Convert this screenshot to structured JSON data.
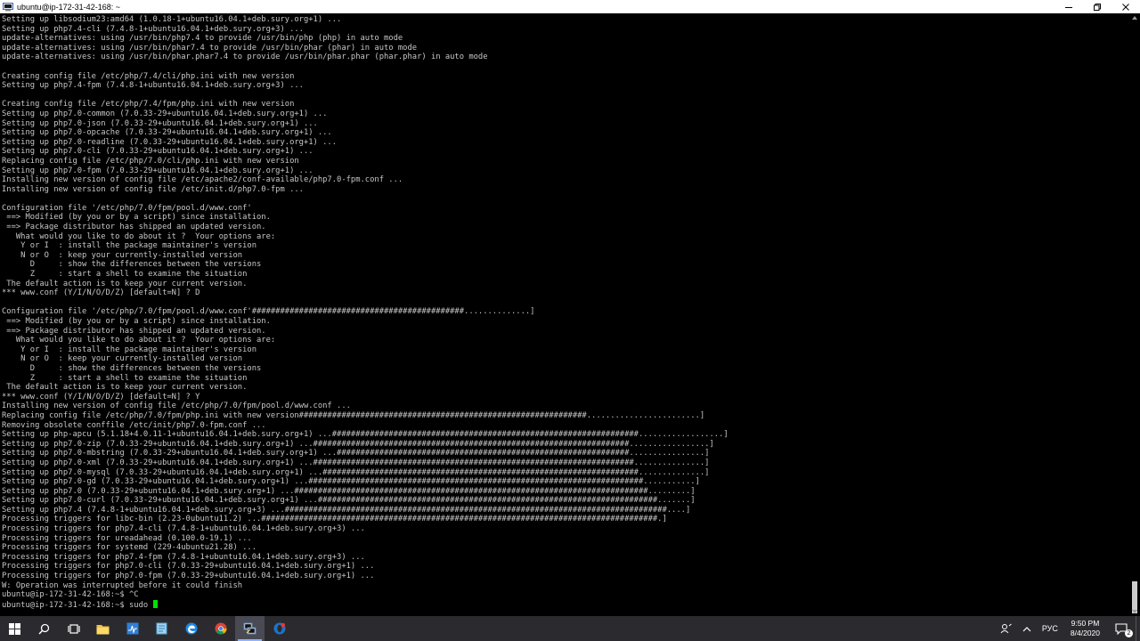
{
  "window": {
    "title": "ubuntu@ip-172-31-42-168: ~"
  },
  "terminal": {
    "lines": [
      "Setting up libsodium23:amd64 (1.0.18-1+ubuntu16.04.1+deb.sury.org+1) ...",
      "Setting up php7.4-cli (7.4.8-1+ubuntu16.04.1+deb.sury.org+3) ...",
      "update-alternatives: using /usr/bin/php7.4 to provide /usr/bin/php (php) in auto mode",
      "update-alternatives: using /usr/bin/phar7.4 to provide /usr/bin/phar (phar) in auto mode",
      "update-alternatives: using /usr/bin/phar.phar7.4 to provide /usr/bin/phar.phar (phar.phar) in auto mode",
      "",
      "Creating config file /etc/php/7.4/cli/php.ini with new version",
      "Setting up php7.4-fpm (7.4.8-1+ubuntu16.04.1+deb.sury.org+3) ...",
      "",
      "Creating config file /etc/php/7.4/fpm/php.ini with new version",
      "Setting up php7.0-common (7.0.33-29+ubuntu16.04.1+deb.sury.org+1) ...",
      "Setting up php7.0-json (7.0.33-29+ubuntu16.04.1+deb.sury.org+1) ...",
      "Setting up php7.0-opcache (7.0.33-29+ubuntu16.04.1+deb.sury.org+1) ...",
      "Setting up php7.0-readline (7.0.33-29+ubuntu16.04.1+deb.sury.org+1) ...",
      "Setting up php7.0-cli (7.0.33-29+ubuntu16.04.1+deb.sury.org+1) ...",
      "Replacing config file /etc/php/7.0/cli/php.ini with new version",
      "Setting up php7.0-fpm (7.0.33-29+ubuntu16.04.1+deb.sury.org+1) ...",
      "Installing new version of config file /etc/apache2/conf-available/php7.0-fpm.conf ...",
      "Installing new version of config file /etc/init.d/php7.0-fpm ...",
      "",
      "Configuration file '/etc/php/7.0/fpm/pool.d/www.conf'",
      " ==> Modified (by you or by a script) since installation.",
      " ==> Package distributor has shipped an updated version.",
      "   What would you like to do about it ?  Your options are:",
      "    Y or I  : install the package maintainer's version",
      "    N or O  : keep your currently-installed version",
      "      D     : show the differences between the versions",
      "      Z     : start a shell to examine the situation",
      " The default action is to keep your current version.",
      "*** www.conf (Y/I/N/O/D/Z) [default=N] ? D",
      "",
      "Configuration file '/etc/php/7.0/fpm/pool.d/www.conf'#############################################..............]",
      " ==> Modified (by you or by a script) since installation.",
      " ==> Package distributor has shipped an updated version.",
      "   What would you like to do about it ?  Your options are:",
      "    Y or I  : install the package maintainer's version",
      "    N or O  : keep your currently-installed version",
      "      D     : show the differences between the versions",
      "      Z     : start a shell to examine the situation",
      " The default action is to keep your current version.",
      "*** www.conf (Y/I/N/O/D/Z) [default=N] ? Y",
      "Installing new version of config file /etc/php/7.0/fpm/pool.d/www.conf ...",
      "Replacing config file /etc/php/7.0/fpm/php.ini with new version#############################################################........................]",
      "Removing obsolete conffile /etc/init/php7.0-fpm.conf ...",
      "Setting up php-apcu (5.1.18+4.0.11-1+ubuntu16.04.1+deb.sury.org+1) ...#################################################################..................]",
      "Setting up php7.0-zip (7.0.33-29+ubuntu16.04.1+deb.sury.org+1) ...###################################################################.................]",
      "Setting up php7.0-mbstring (7.0.33-29+ubuntu16.04.1+deb.sury.org+1) ...##############################################################................]",
      "Setting up php7.0-xml (7.0.33-29+ubuntu16.04.1+deb.sury.org+1) ...####################################################################...............]",
      "Setting up php7.0-mysql (7.0.33-29+ubuntu16.04.1+deb.sury.org+1) ...###################################################################..............]",
      "Setting up php7.0-gd (7.0.33-29+ubuntu16.04.1+deb.sury.org+1) ...#######################################################################...........]",
      "Setting up php7.0 (7.0.33-29+ubuntu16.04.1+deb.sury.org+1) ...###########################################################################.........]",
      "Setting up php7.0-curl (7.0.33-29+ubuntu16.04.1+deb.sury.org+1) ...########################################################################.......]",
      "Setting up php7.4 (7.4.8-1+ubuntu16.04.1+deb.sury.org+3) ...#################################################################################....]",
      "Processing triggers for libc-bin (2.23-0ubuntu11.2) ...####################################################################################.]",
      "Processing triggers for php7.4-cli (7.4.8-1+ubuntu16.04.1+deb.sury.org+3) ...",
      "Processing triggers for ureadahead (0.100.0-19.1) ...",
      "Processing triggers for systemd (229-4ubuntu21.28) ...",
      "Processing triggers for php7.4-fpm (7.4.8-1+ubuntu16.04.1+deb.sury.org+3) ...",
      "Processing triggers for php7.0-cli (7.0.33-29+ubuntu16.04.1+deb.sury.org+1) ...",
      "Processing triggers for php7.0-fpm (7.0.33-29+ubuntu16.04.1+deb.sury.org+1) ...",
      "W: Operation was interrupted before it could finish",
      "ubuntu@ip-172-31-42-168:~$ ^C"
    ],
    "prompt": "ubuntu@ip-172-31-42-168:~$ sudo "
  },
  "taskbar": {
    "apps": [
      {
        "name": "file-explorer-icon",
        "running": false
      },
      {
        "name": "task-manager-icon",
        "running": false
      },
      {
        "name": "notepad-icon",
        "running": false
      },
      {
        "name": "edge-browser-icon",
        "running": false
      },
      {
        "name": "chrome-browser-icon",
        "running": false
      },
      {
        "name": "putty-icon",
        "running": true,
        "active": true
      },
      {
        "name": "opera-browser-icon",
        "running": false
      }
    ],
    "language": "РУС",
    "time": "9:50 PM",
    "date": "8/4/2020",
    "notification_count": "2"
  },
  "colors": {
    "terminal_bg": "#000000",
    "terminal_fg": "#c7c7c7",
    "cursor": "#00e000",
    "taskbar_bg": "#2b2b2f"
  }
}
